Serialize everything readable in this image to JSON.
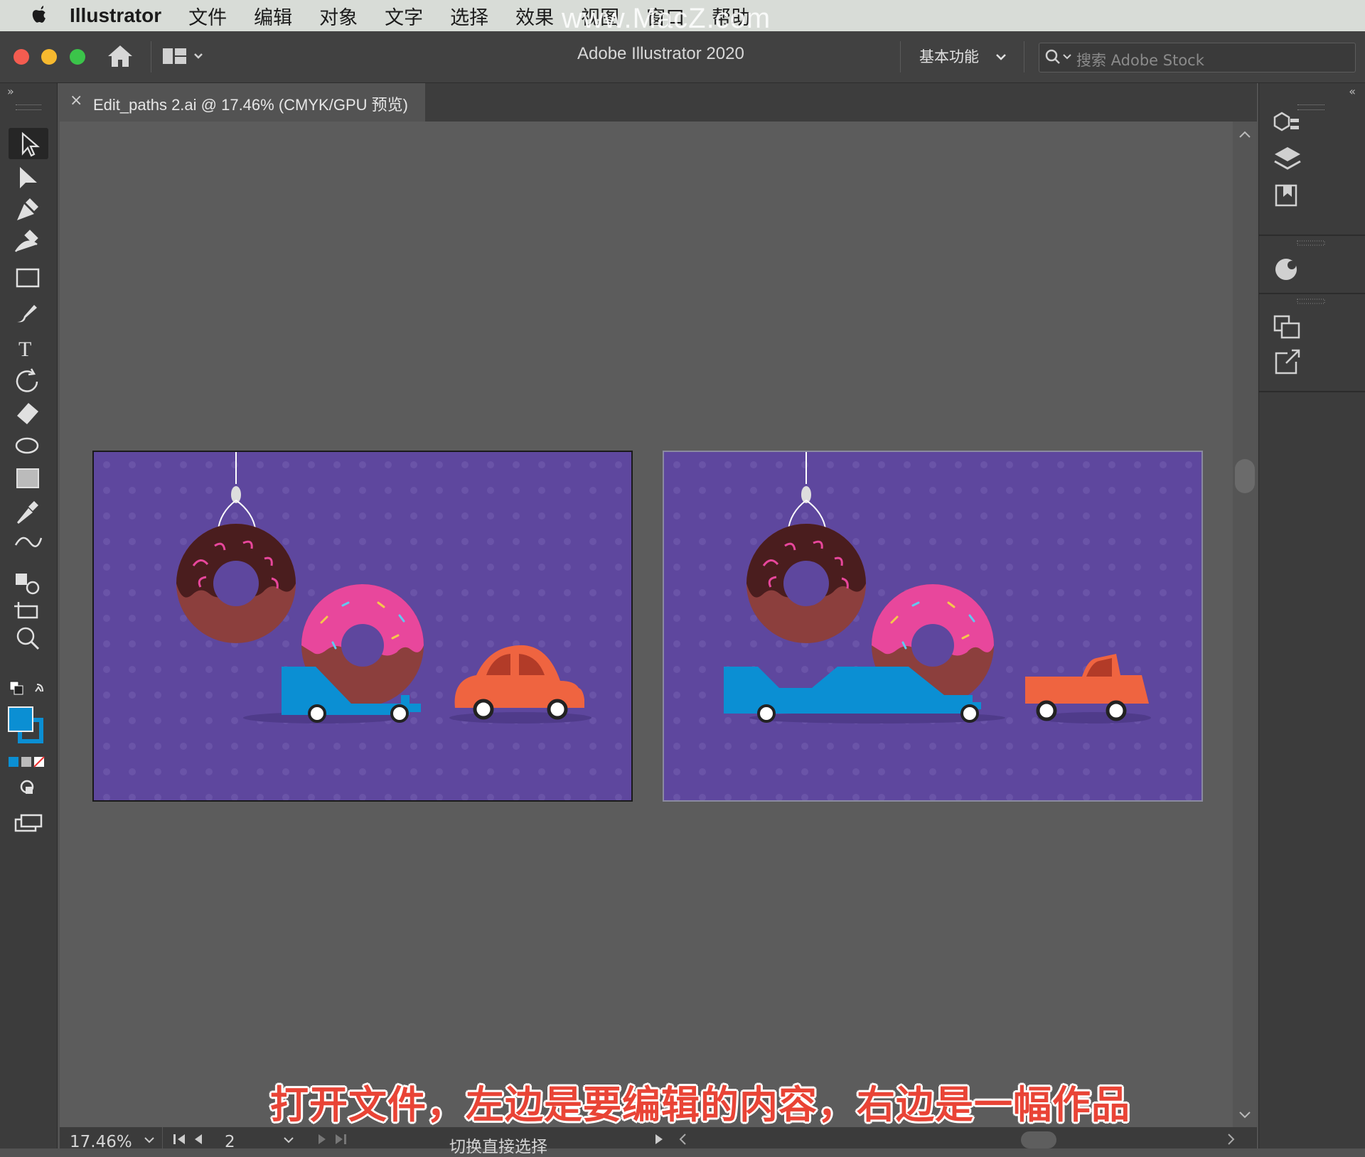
{
  "menubar": {
    "app_name": "Illustrator",
    "items": [
      "文件",
      "编辑",
      "对象",
      "文字",
      "选择",
      "效果",
      "视图",
      "窗口",
      "帮助"
    ]
  },
  "watermark": "www.MacZ.com",
  "appbar": {
    "title": "Adobe Illustrator 2020",
    "workspace": "基本功能",
    "search_placeholder": "搜索 Adobe Stock"
  },
  "document_tab": {
    "close": "×",
    "label": "Edit_paths 2.ai @ 17.46% (CMYK/GPU 预览)"
  },
  "status": {
    "zoom": "17.46%",
    "artboard": "2",
    "tool_hint": "切换直接选择"
  },
  "caption": "打开文件，左边是要编辑的内容，右边是一幅作品",
  "colors": {
    "artboard": "#5e479e",
    "fill_swatch": "#0b8fd3",
    "car": "#ef6440",
    "trailer": "#0b8fd3",
    "frosting_pink": "#e8479c",
    "chocolate": "#4a1d1e",
    "dough": "#8c3f3d",
    "caption": "#e94436"
  },
  "tools": [
    "selection-tool",
    "direct-selection-tool",
    "pen-tool",
    "curvature-tool",
    "rectangle-tool",
    "paintbrush-tool",
    "type-tool",
    "rotate-tool",
    "eraser-tool",
    "lasso-tool",
    "gradient-tool",
    "eyedropper-tool",
    "blend-tool",
    "shape-builder-tool",
    "artboard-tool",
    "zoom-tool"
  ],
  "right_panels": [
    "properties-icon",
    "layers-icon",
    "libraries-icon",
    "color-icon",
    "transform-icon",
    "export-icon"
  ]
}
